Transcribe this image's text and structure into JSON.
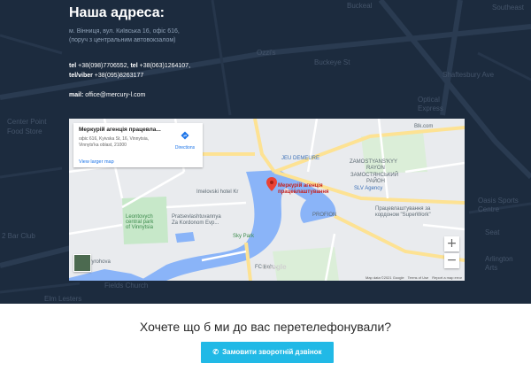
{
  "address": {
    "title": "Наша адреса:",
    "line1": "м. Вінниця, вул. Київська 16, офіс 616,",
    "line2": "(поруч з центральним автовокзалом)",
    "tel_label": "tel",
    "tel_value1": " +38(098)7706552,",
    "tel_label2": " tel",
    "tel_value2": " +38(063)1264107,",
    "viber_label": "tel/viber",
    "viber_value": " +38(095)8263177",
    "mail_label": "mail:",
    "mail_value": " office@mercury-l.com"
  },
  "background_labels": {
    "bucksal": "Buckeal",
    "ozzis": "Ozzi's",
    "buckeye": "Buckeye St",
    "southeast": "Southeast",
    "shaftesbury": "Shaftesbury Ave",
    "optical": "Optical",
    "express": "Express",
    "center_point": "Center Point",
    "food_store": "Food Store",
    "bar_club": "2 Bar Club",
    "fields_church": "Fields Church",
    "elm_lesters": "Elm Lesters",
    "oasis": "Oasis Sports",
    "centre": "Centre",
    "seat": "Seat",
    "arlington": "Arlington",
    "arts": "Arts"
  },
  "map": {
    "place_name": "Меркурій агенція працевла...",
    "place_address": "офіс 616, Kyivska St, 16, Vinnytsia, Vinnyts'ka oblast, 21000",
    "view_larger": "View larger map",
    "directions": "Directions",
    "pin_label": "Меркурій агенція працевлаштування",
    "zoom_in": "+",
    "zoom_out": "−",
    "footer_data": "Map data ©2021 Google",
    "footer_terms": "Terms of Use",
    "footer_report": "Report a map error",
    "google": "Google",
    "labels": {
      "blk": "Blk.com",
      "jeu": "JEU DEMEURE",
      "zamost_1": "ZAMOSTYANS'KYY",
      "zamost_2": "RAYON",
      "zamost_3": "ЗАМОСТЯНСЬКИЙ",
      "zamost_4": "РАЙОН",
      "slv": "SLV Agency",
      "work_1": "Працевлаштування за",
      "work_2": "кордоном \"SuperWork\"",
      "profion": "PROFION",
      "hotel": "Imelovski hotel Kr",
      "park_1": "Leontovych",
      "park_2": "central park",
      "park_3": "of Vinnytsia",
      "prats_1": "Pratsevlashtuvannya",
      "prats_2": "Za Kordonom Evp...",
      "sky": "Sky Park",
      "pyrohova": "м. Pyrohova",
      "fcb": "FC Boh..."
    }
  },
  "callback": {
    "prompt": "Хочете що б ми до вас перетелефонували?",
    "button": "Замовити зворотній дзвінок"
  },
  "colors": {
    "hero_bg": "#1c2b3e",
    "button_bg": "#21b9e6",
    "pin": "#ea4335",
    "water": "#8ab4f8"
  }
}
